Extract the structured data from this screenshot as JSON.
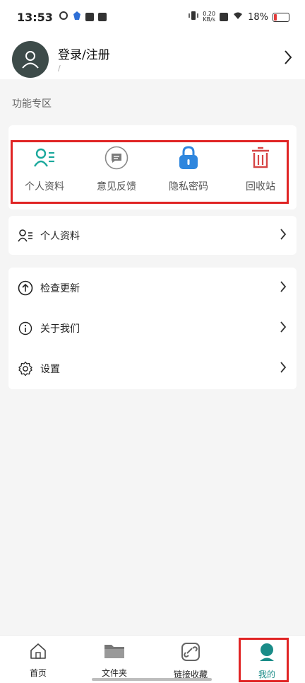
{
  "status_bar": {
    "time": "13:53",
    "net_speed_value": "0.20",
    "net_speed_unit": "KB/s",
    "battery": "18%"
  },
  "header": {
    "title": "登录/注册",
    "subtitle": "/"
  },
  "section": {
    "label": "功能专区"
  },
  "quick_actions": [
    {
      "label": "个人资料",
      "icon": "person-list-icon",
      "color": "#1aa89c"
    },
    {
      "label": "意见反馈",
      "icon": "chat-bubble-icon",
      "color": "#7b7b7b"
    },
    {
      "label": "隐私密码",
      "icon": "lock-icon",
      "color": "#2e86de"
    },
    {
      "label": "回收站",
      "icon": "trash-icon",
      "color": "#d64545"
    }
  ],
  "list_group_1": [
    {
      "label": "个人资料",
      "icon": "person-list-icon"
    }
  ],
  "list_group_2": [
    {
      "label": "检查更新",
      "icon": "arrow-up-circle-icon"
    },
    {
      "label": "关于我们",
      "icon": "info-icon"
    },
    {
      "label": "设置",
      "icon": "gear-icon"
    }
  ],
  "bottom_nav": [
    {
      "label": "首页",
      "icon": "home-icon",
      "active": false
    },
    {
      "label": "文件夹",
      "icon": "folder-icon",
      "active": false
    },
    {
      "label": "链接收藏",
      "icon": "link-icon",
      "active": false
    },
    {
      "label": "我的",
      "icon": "user-icon",
      "active": true
    }
  ],
  "colors": {
    "accent": "#1a8c88",
    "highlight": "#e02424",
    "avatar_bg": "#3d4b49"
  }
}
